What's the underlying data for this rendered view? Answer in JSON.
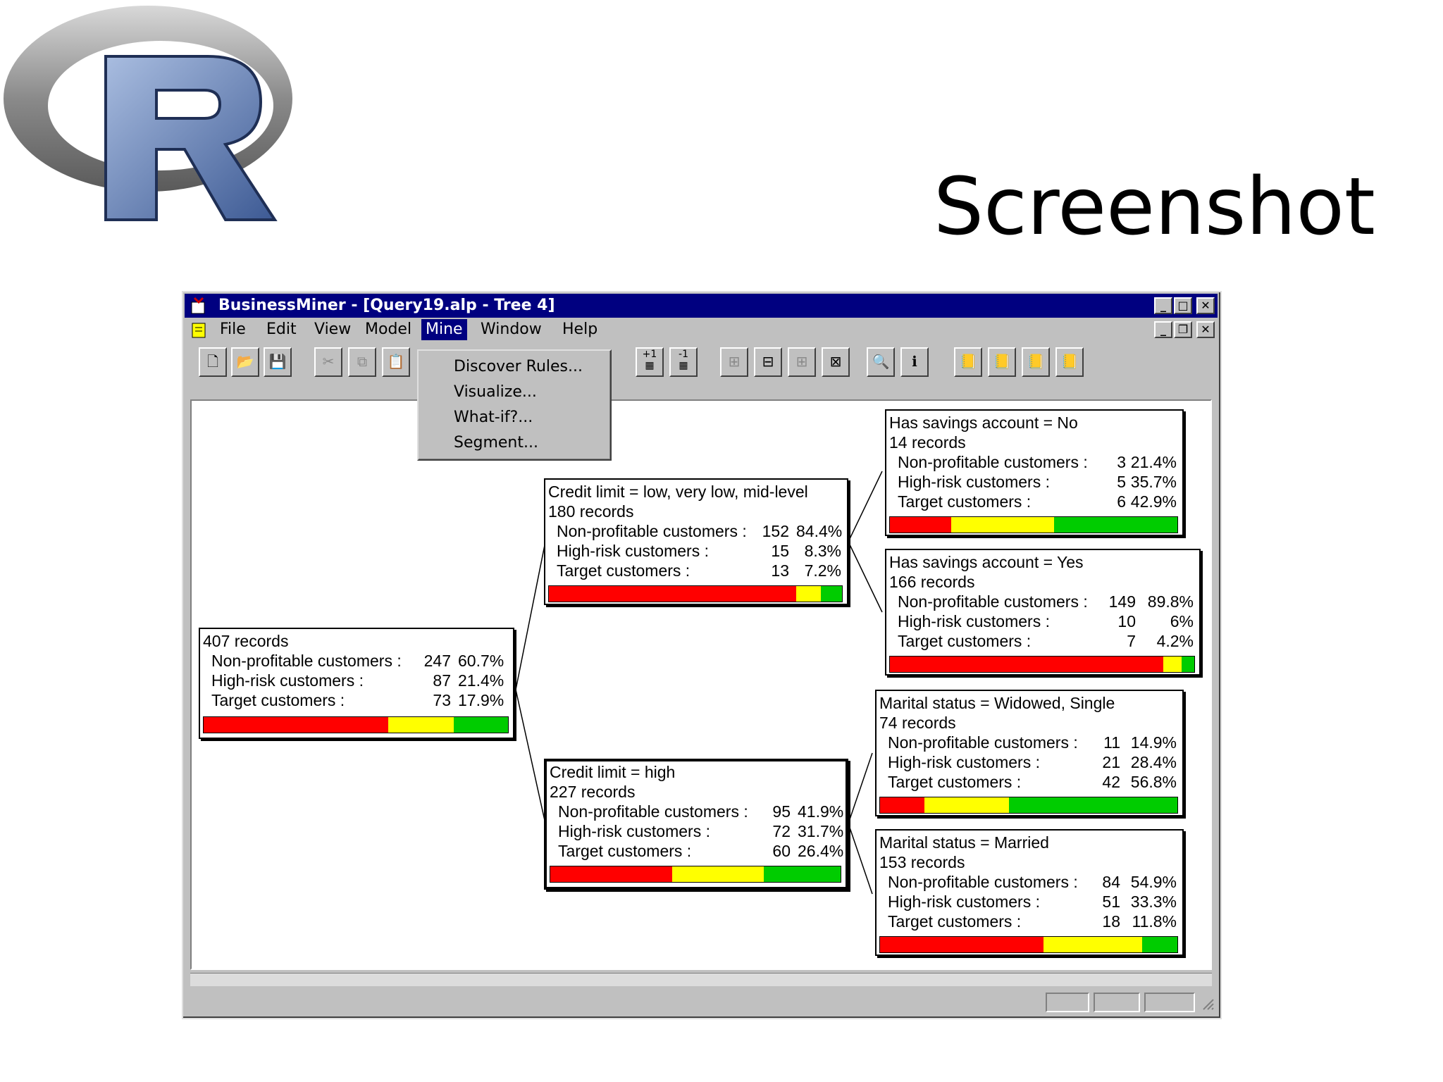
{
  "slide": {
    "title": "Screenshot"
  },
  "window": {
    "title": "BusinessMiner - [Query19.alp - Tree 4]"
  },
  "menu": [
    {
      "label": "File"
    },
    {
      "label": "Edit"
    },
    {
      "label": "View"
    },
    {
      "label": "Model"
    },
    {
      "label": "Mine"
    },
    {
      "label": "Window"
    },
    {
      "label": "Help"
    }
  ],
  "mine_menu": [
    {
      "label": "Discover Rules..."
    },
    {
      "label": "Visualize..."
    },
    {
      "label": "What-if?..."
    },
    {
      "label": "Segment..."
    }
  ],
  "toolbar": {
    "icons": [
      "new-icon",
      "open-icon",
      "save-icon",
      "cut-icon",
      "copy-icon",
      "paste-icon",
      "expand-level-icon",
      "collapse-level-icon",
      "tree-icon-1",
      "tree-icon-2",
      "tree-icon-3",
      "tree-icon-4",
      "find-icon",
      "info-icon",
      "query-icon-1",
      "query-icon-2",
      "query-icon-3",
      "query-icon-4"
    ],
    "expand_label": "+1",
    "collapse_label": "-1"
  },
  "colors": {
    "red": "#ff0000",
    "yellow": "#ffff00",
    "green": "#00cc00",
    "titlebar": "#000080"
  },
  "row_labels": [
    "Non-profitable customers :",
    "High-risk customers :",
    "Target customers :"
  ],
  "tree": {
    "root": {
      "header": "",
      "records": "407 records",
      "rows": [
        [
          "247",
          "60.7%"
        ],
        [
          "87",
          "21.4%"
        ],
        [
          "73",
          "17.9%"
        ]
      ],
      "dist": [
        60.7,
        21.4,
        17.9
      ]
    },
    "n1": {
      "header": "Credit limit = low, very low, mid-level",
      "records": "180 records",
      "rows": [
        [
          "152",
          "84.4%"
        ],
        [
          "15",
          "8.3%"
        ],
        [
          "13",
          "7.2%"
        ]
      ],
      "dist": [
        84.4,
        8.3,
        7.2
      ]
    },
    "n2": {
      "header": "Credit limit = high",
      "records": "227 records",
      "rows": [
        [
          "95",
          "41.9%"
        ],
        [
          "72",
          "31.7%"
        ],
        [
          "60",
          "26.4%"
        ]
      ],
      "dist": [
        41.9,
        31.7,
        26.4
      ]
    },
    "n11": {
      "header": "Has savings account = No",
      "records": "14 records",
      "rows": [
        [
          "3",
          "21.4%"
        ],
        [
          "5",
          "35.7%"
        ],
        [
          "6",
          "42.9%"
        ]
      ],
      "dist": [
        21.4,
        35.7,
        42.9
      ]
    },
    "n12": {
      "header": "Has savings account = Yes",
      "records": "166 records",
      "rows": [
        [
          "149",
          "89.8%"
        ],
        [
          "10",
          "6%"
        ],
        [
          "7",
          "4.2%"
        ]
      ],
      "dist": [
        89.8,
        6,
        4.2
      ]
    },
    "n21": {
      "header": "Marital status = Widowed, Single",
      "records": "74 records",
      "rows": [
        [
          "11",
          "14.9%"
        ],
        [
          "21",
          "28.4%"
        ],
        [
          "42",
          "56.8%"
        ]
      ],
      "dist": [
        14.9,
        28.4,
        56.8
      ]
    },
    "n22": {
      "header": "Marital status = Married",
      "records": "153 records",
      "rows": [
        [
          "84",
          "54.9%"
        ],
        [
          "51",
          "33.3%"
        ],
        [
          "18",
          "11.8%"
        ]
      ],
      "dist": [
        54.9,
        33.3,
        11.8
      ]
    }
  }
}
